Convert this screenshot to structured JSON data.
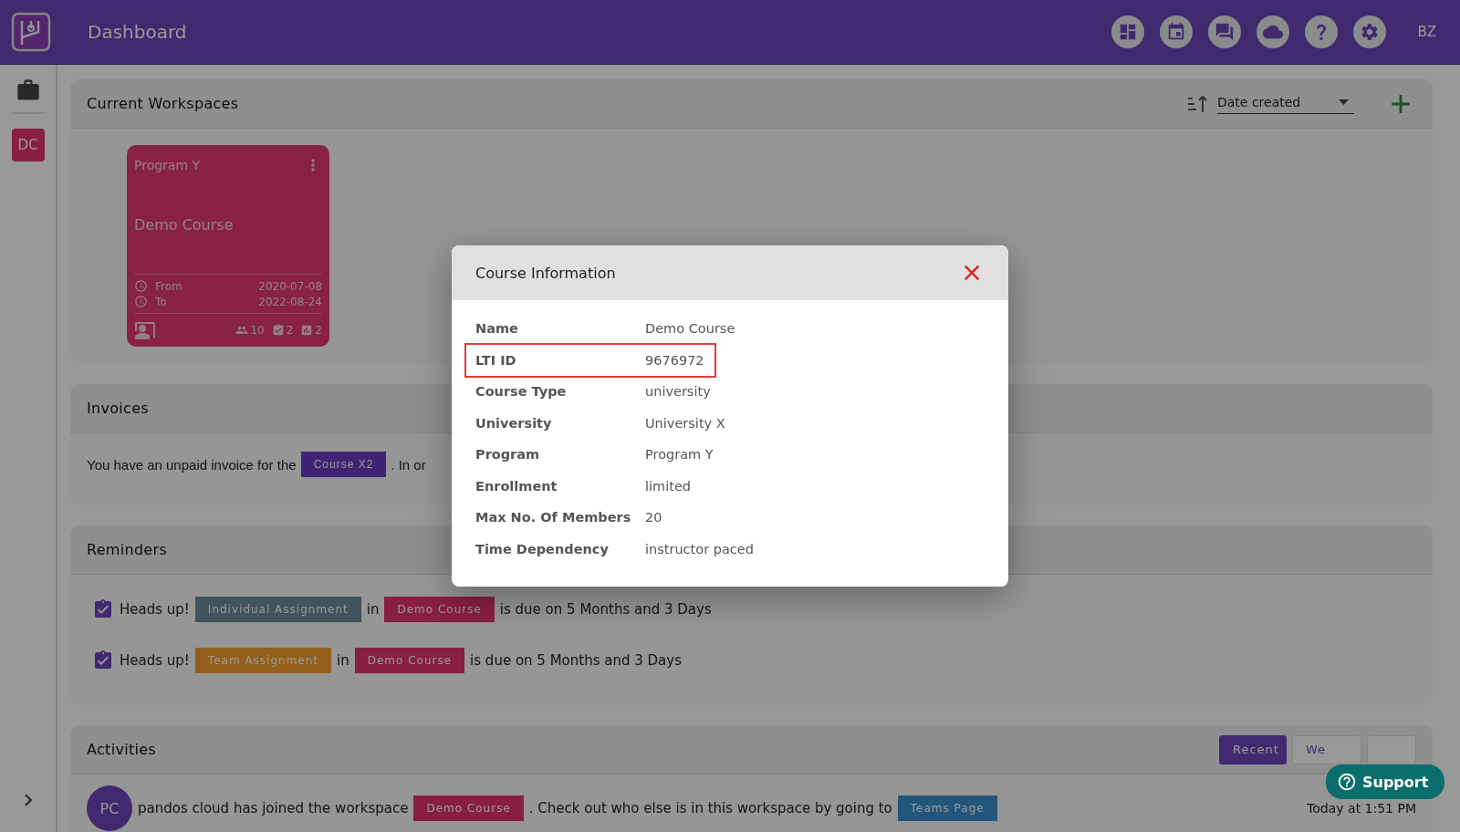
{
  "header": {
    "title": "Dashboard",
    "user_initials": "BZ"
  },
  "sidebar": {
    "workspaces": [
      {
        "initials": "DC"
      }
    ]
  },
  "workspaces": {
    "title": "Current Workspaces",
    "sort": {
      "value": "Date created"
    },
    "cards": [
      {
        "program": "Program Y",
        "name": "Demo Course",
        "from_label": "From",
        "from": "2020-07-08",
        "to_label": "To",
        "to": "2022-08-24",
        "members": "10",
        "assignments": "2",
        "reports": "2"
      }
    ]
  },
  "invoices": {
    "title": "Invoices",
    "message": {
      "before": "You have an unpaid invoice for the",
      "badge": "Course X2",
      "after": ". In or"
    }
  },
  "reminders": {
    "title": "Reminders",
    "items": [
      {
        "lead": "Heads up!",
        "assignment": "Individual Assignment",
        "kind": "individual",
        "joiner": "in",
        "course": "Demo Course",
        "due": "is due on 5 Months and 3 Days"
      },
      {
        "lead": "Heads up!",
        "assignment": "Team Assignment",
        "kind": "team",
        "joiner": "in",
        "course": "Demo Course",
        "due": "is due on 5 Months and 3 Days"
      }
    ]
  },
  "activities": {
    "title": "Activities",
    "filters": [
      {
        "label": "Recent",
        "selected": true
      },
      {
        "label": "We",
        "selected": false
      },
      {
        "selected": false
      }
    ],
    "items": [
      {
        "avatar": "PC",
        "user": "pandos cloud",
        "text": "has joined the workspace",
        "course": "Demo Course",
        "text2": ". Check out who else is in this workspace by going to",
        "link": "Teams Page",
        "time": "Today at 1:51 PM"
      }
    ]
  },
  "support": {
    "label": "Support"
  },
  "modal": {
    "title": "Course Information",
    "rows": [
      {
        "label": "Name",
        "value": "Demo Course",
        "highlighted": false
      },
      {
        "label": "LTI ID",
        "value": "9676972",
        "highlighted": true
      },
      {
        "label": "Course Type",
        "value": "university",
        "highlighted": false
      },
      {
        "label": "University",
        "value": "University X",
        "highlighted": false
      },
      {
        "label": "Program",
        "value": "Program Y",
        "highlighted": false
      },
      {
        "label": "Enrollment",
        "value": "limited",
        "highlighted": false
      },
      {
        "label": "Max No. Of Members",
        "value": "20",
        "highlighted": false
      },
      {
        "label": "Time Dependency",
        "value": "instructor paced",
        "highlighted": false
      }
    ]
  }
}
